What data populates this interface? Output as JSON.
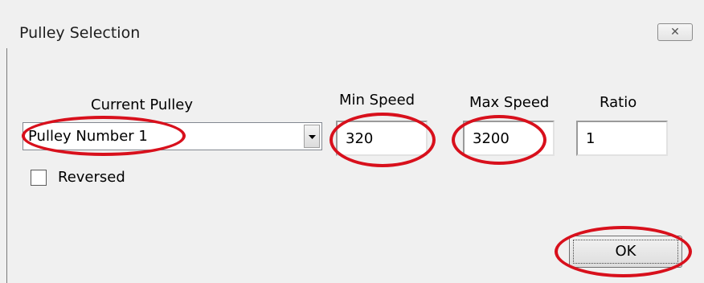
{
  "window": {
    "title": "Pulley Selection",
    "close_glyph": "✕"
  },
  "labels": {
    "current_pulley": "Current Pulley",
    "min_speed": "Min Speed",
    "max_speed": "Max Speed",
    "ratio": "Ratio",
    "reversed": "Reversed"
  },
  "fields": {
    "current_pulley": "Pulley Number 1",
    "min_speed": "320",
    "max_speed": "3200",
    "ratio": "1"
  },
  "reversed_checked": false,
  "buttons": {
    "ok": "OK"
  },
  "colors": {
    "annotation": "#d8101c",
    "dialog_background": "#f0f0f0"
  }
}
